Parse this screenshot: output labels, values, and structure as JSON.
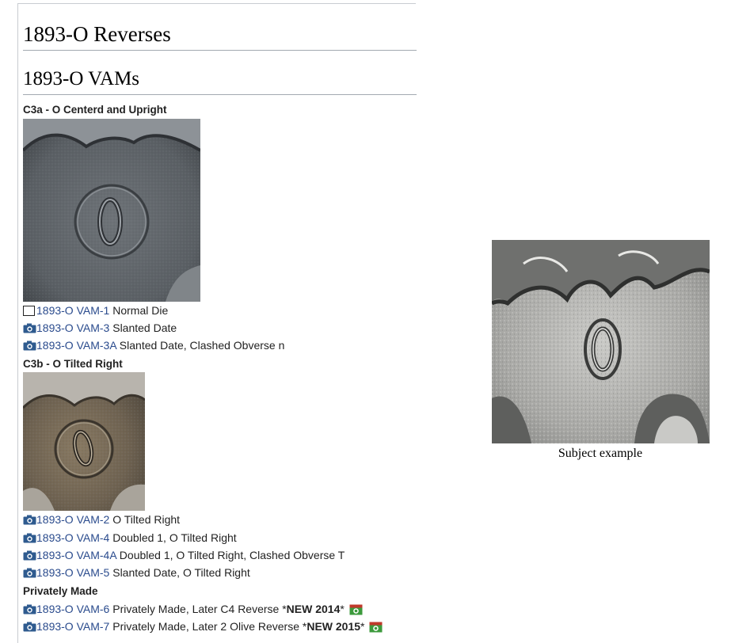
{
  "page": {
    "heading": "1893-O Reverses",
    "subheading": "1893-O VAMs"
  },
  "groups": [
    {
      "title": "C3a - O Centerd and Upright",
      "items": [
        {
          "icon": "empty-box-icon",
          "link": "1893-O VAM-1",
          "desc": "Normal Die"
        },
        {
          "icon": "camera-icon",
          "link": "1893-O VAM-3",
          "desc": "Slanted Date"
        },
        {
          "icon": "camera-icon",
          "link": "1893-O VAM-3A",
          "desc": "Slanted Date, Clashed Obverse n"
        }
      ]
    },
    {
      "title": "C3b - O Tilted Right",
      "items": [
        {
          "icon": "camera-icon",
          "link": "1893-O VAM-2",
          "desc": "O Tilted Right"
        },
        {
          "icon": "camera-icon",
          "link": "1893-O VAM-4",
          "desc": "Doubled 1, O Tilted Right"
        },
        {
          "icon": "camera-icon",
          "link": "1893-O VAM-4A",
          "desc": "Doubled 1, O Tilted Right, Clashed Obverse T"
        },
        {
          "icon": "camera-icon",
          "link": "1893-O VAM-5",
          "desc": "Slanted Date, O Tilted Right"
        }
      ]
    },
    {
      "title": "Privately Made",
      "items": [
        {
          "icon": "camera-icon",
          "link": "1893-O VAM-6",
          "desc": "Privately Made, Later C4 Reverse *",
          "new": "NEW 2014",
          "after": "*"
        },
        {
          "icon": "camera-icon",
          "link": "1893-O VAM-7",
          "desc": "Privately Made, Later 2 Olive Reverse *",
          "new": "NEW 2015",
          "after": "*"
        }
      ]
    }
  ],
  "subject": {
    "caption": "Subject example"
  },
  "colors": {
    "link": "#2a4b8d",
    "camera": "#2f5b8f",
    "new_icon": "#3c9a3c"
  }
}
